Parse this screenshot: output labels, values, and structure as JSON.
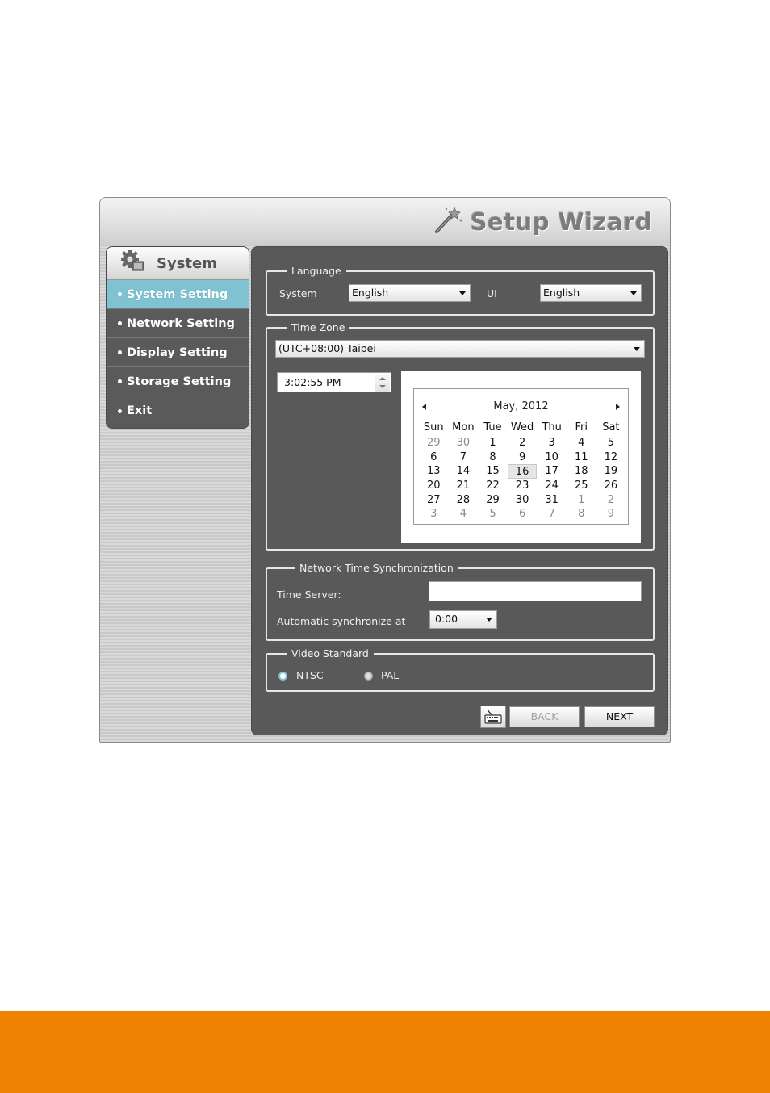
{
  "window": {
    "title": "Setup Wizard"
  },
  "sidebar": {
    "header": "System",
    "items": [
      {
        "label": "System Setting",
        "active": true
      },
      {
        "label": "Network Setting",
        "active": false
      },
      {
        "label": "Display Setting",
        "active": false
      },
      {
        "label": "Storage Setting",
        "active": false
      },
      {
        "label": "Exit",
        "active": false
      }
    ]
  },
  "language": {
    "legend": "Language",
    "system_label": "System",
    "system_value": "English",
    "ui_label": "UI",
    "ui_value": "English"
  },
  "timezone": {
    "legend": "Time Zone",
    "value": "(UTC+08:00) Taipei",
    "time_value": "3:02:55 PM"
  },
  "calendar": {
    "title": "May, 2012",
    "day_headers": [
      "Sun",
      "Mon",
      "Tue",
      "Wed",
      "Thu",
      "Fri",
      "Sat"
    ],
    "days": [
      "29",
      "30",
      "1",
      "2",
      "3",
      "4",
      "5",
      "6",
      "7",
      "8",
      "9",
      "10",
      "11",
      "12",
      "13",
      "14",
      "15",
      "16",
      "17",
      "18",
      "19",
      "20",
      "21",
      "22",
      "23",
      "24",
      "25",
      "26",
      "27",
      "28",
      "29",
      "30",
      "31",
      "1",
      "2",
      "3",
      "4",
      "5",
      "6",
      "7",
      "8",
      "9"
    ],
    "other_month_indices": [
      0,
      1,
      33,
      34,
      35,
      36,
      37,
      38,
      39,
      40,
      41
    ],
    "today_index": 17
  },
  "ntp": {
    "legend": "Network Time Synchronization",
    "server_label": "Time Server:",
    "server_value": "",
    "sync_label": "Automatic synchronize at",
    "sync_value": "0:00"
  },
  "video": {
    "legend": "Video Standard",
    "ntsc_label": "NTSC",
    "pal_label": "PAL",
    "selected": "NTSC"
  },
  "buttons": {
    "back": "BACK",
    "next": "NEXT"
  },
  "colors": {
    "accent": "#7fc3d3",
    "panel": "#595959",
    "footer": "#ef8200"
  }
}
